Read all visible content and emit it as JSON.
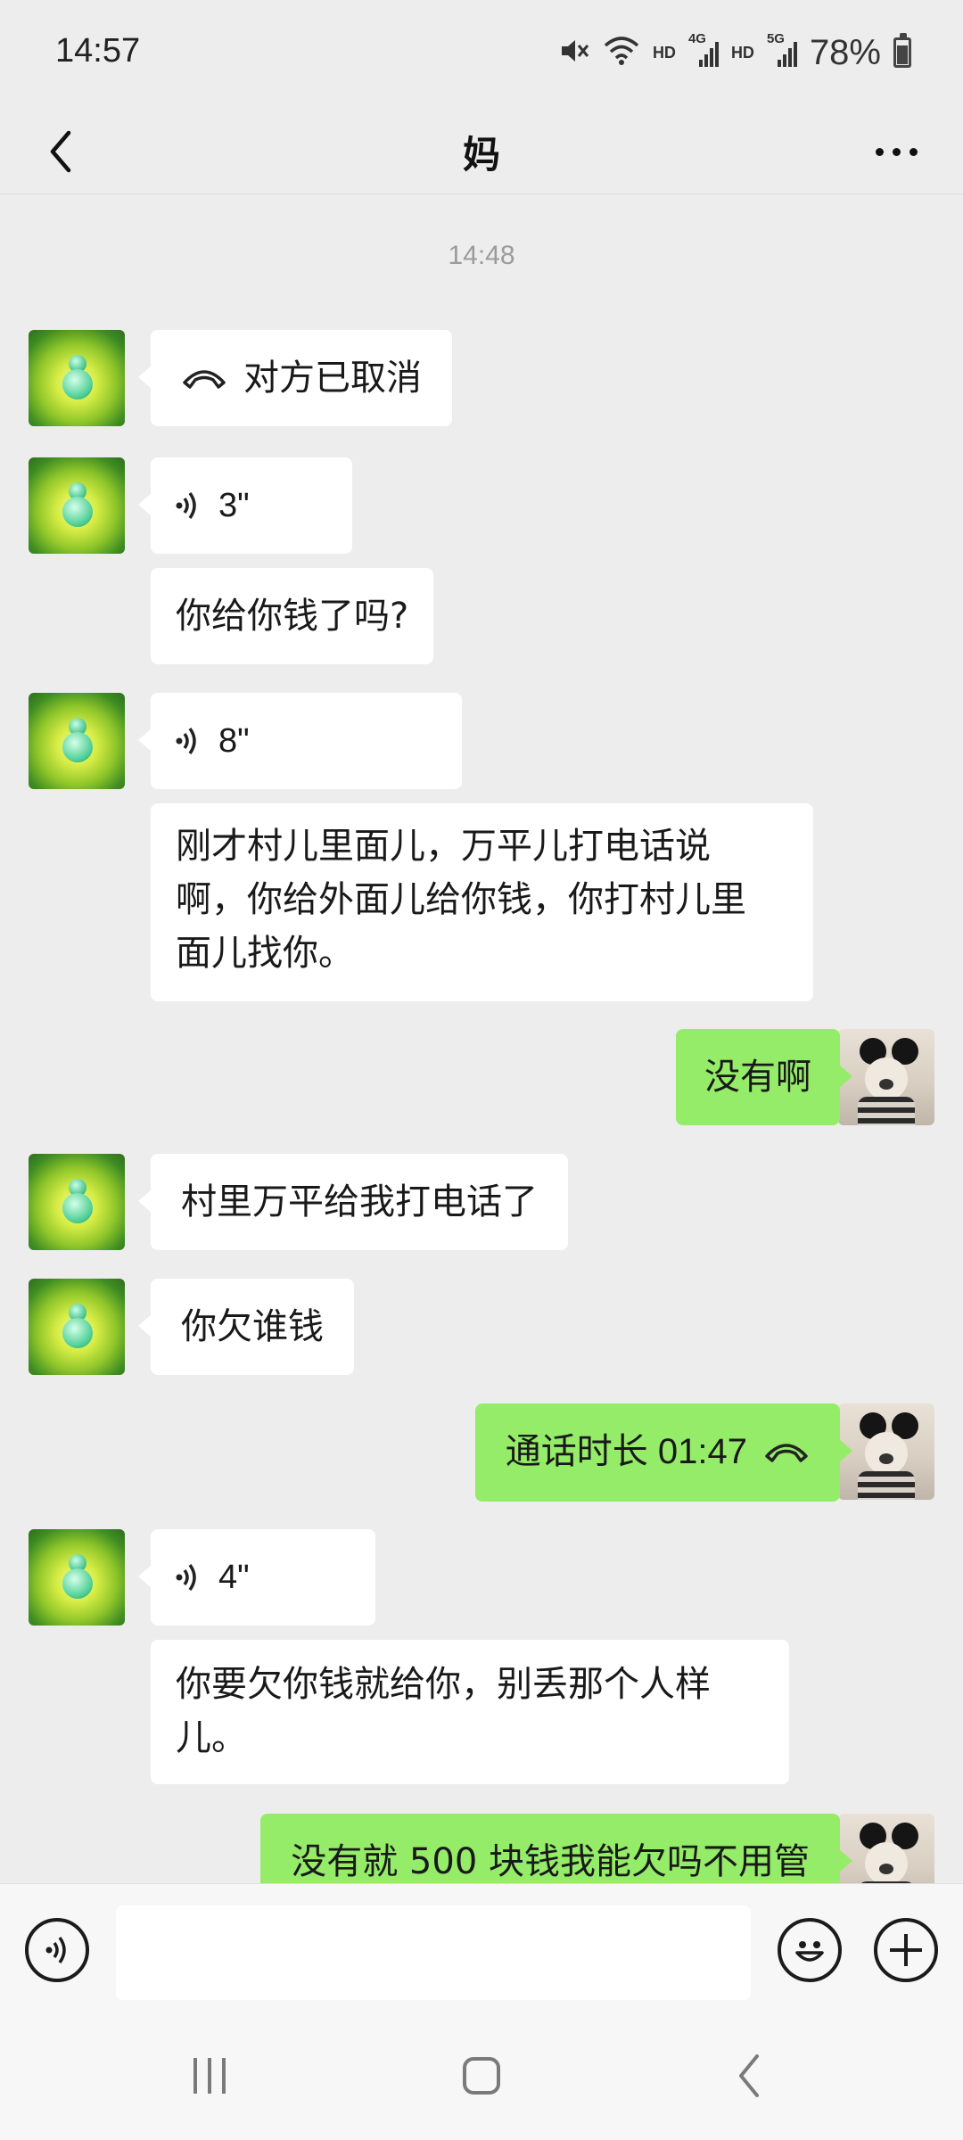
{
  "status_bar": {
    "time": "14:57",
    "hd1": "HD",
    "net1": "4G",
    "hd2": "HD",
    "net2": "5G",
    "battery": "78%"
  },
  "header": {
    "title": "妈"
  },
  "chat": {
    "timestamp": "14:48",
    "messages": [
      {
        "side": "left",
        "type": "call",
        "text": "对方已取消"
      },
      {
        "side": "left",
        "type": "voice",
        "duration": "3\""
      },
      {
        "side": "left",
        "type": "text",
        "text": "你给你钱了吗?"
      },
      {
        "side": "left",
        "type": "voice",
        "duration": "8\""
      },
      {
        "side": "left",
        "type": "text",
        "line1": "刚才村儿里面儿，万平儿打电话说",
        "line2": "啊，你给外面儿给你钱，你打村儿里",
        "line3": "面儿找你。"
      },
      {
        "side": "right",
        "type": "text",
        "text": "没有啊"
      },
      {
        "side": "left",
        "type": "text",
        "text": "村里万平给我打电话了"
      },
      {
        "side": "left",
        "type": "text",
        "text": "你欠谁钱"
      },
      {
        "side": "right",
        "type": "call",
        "text": "通话时长 01:47"
      },
      {
        "side": "left",
        "type": "voice",
        "duration": "4\""
      },
      {
        "side": "left",
        "type": "text",
        "line1": "你要欠你钱就给你，别丢那个人样",
        "line2": "儿。"
      },
      {
        "side": "right",
        "type": "text",
        "text": "没有就 500 块钱我能欠吗不用管"
      }
    ]
  },
  "input": {
    "value": "",
    "placeholder": ""
  },
  "icons": {
    "back": "back-chevron-icon",
    "more": "more-dots-icon",
    "voice": "voice-wave-icon",
    "call": "phone-hangup-icon",
    "emoji": "emoji-icon",
    "plus": "plus-icon"
  },
  "colors": {
    "background": "#ededed",
    "bubble_self": "#95ec69",
    "bubble_other": "#ffffff"
  }
}
